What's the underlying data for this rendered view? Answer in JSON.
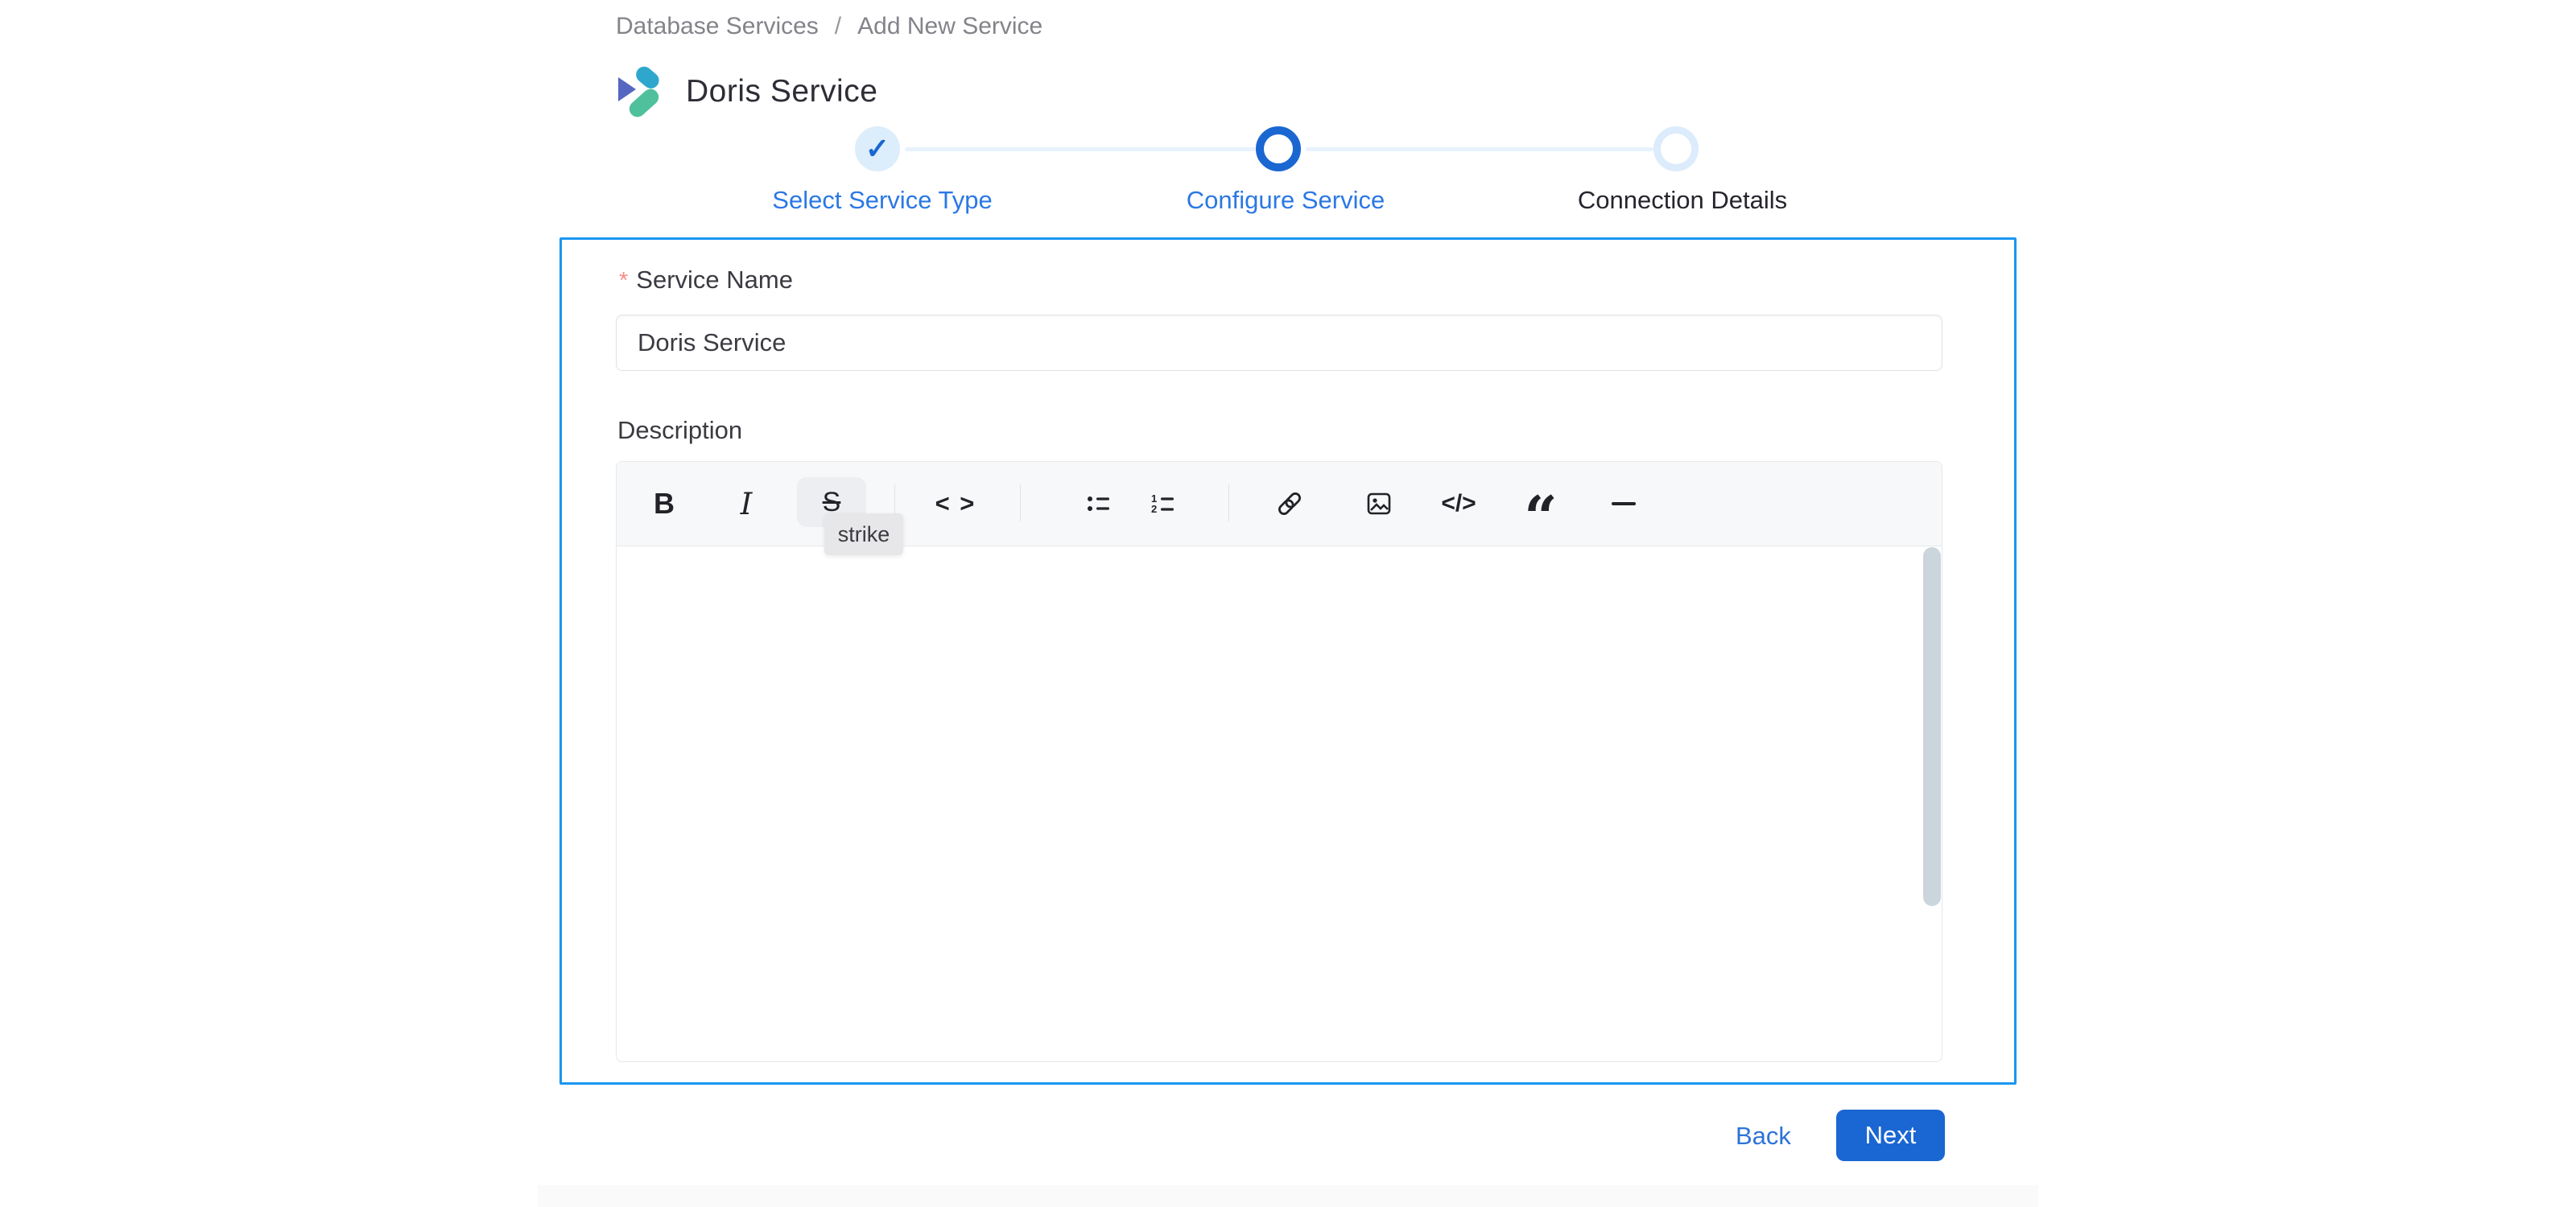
{
  "breadcrumb": {
    "items": [
      {
        "label": "Database Services"
      },
      {
        "label": "Add New Service"
      }
    ],
    "separator": "/"
  },
  "header": {
    "title": "Doris Service",
    "logo": "doris-logo"
  },
  "stepper": {
    "steps": [
      {
        "label": "Select Service Type",
        "state": "completed"
      },
      {
        "label": "Configure Service",
        "state": "active"
      },
      {
        "label": "Connection Details",
        "state": "upcoming"
      }
    ]
  },
  "icons": {
    "check": "✓"
  },
  "form": {
    "service_name": {
      "label": "Service Name",
      "required_marker": "*",
      "value": "Doris Service"
    },
    "description": {
      "label": "Description",
      "value": ""
    }
  },
  "editor": {
    "toolbar": {
      "bold": "B",
      "italic": "I",
      "strike": "S",
      "inline_code": "< >",
      "code_block": "</>",
      "quote": "“",
      "horizontal_rule": "—"
    },
    "tooltip": "strike"
  },
  "actions": {
    "back": "Back",
    "next": "Next"
  },
  "colors": {
    "panel_border": "#1b96f0",
    "primary_blue": "#1a66d2",
    "step_label_blue": "#2b78e4",
    "completed_circle_bg": "#dcedfb",
    "upcoming_ring": "#dcecfc",
    "connector": "#e8f2fd",
    "toolbar_bg": "#f7f8fa",
    "tooltip_bg": "#e7e7e9",
    "scrollbar_thumb": "#cbd5dc",
    "breadcrumb_gray": "#83838a",
    "logo_cyan": "#2fa7cd",
    "logo_indigo": "#5567c0",
    "logo_green": "#4fc09c"
  }
}
